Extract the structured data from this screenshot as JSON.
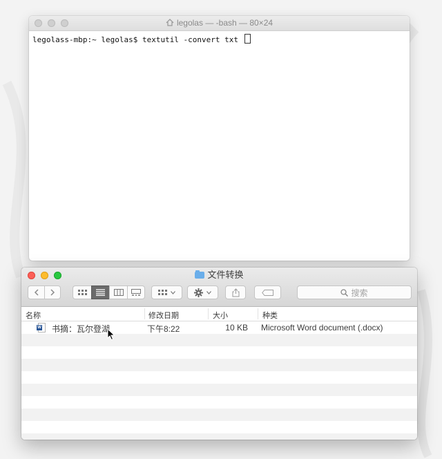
{
  "terminal": {
    "title": "legolas — -bash — 80×24",
    "prompt": "legolass-mbp:~ legolas$ ",
    "command": "textutil -convert txt"
  },
  "finder": {
    "title": "文件转换",
    "search_placeholder": "搜索",
    "columns": {
      "name": "名称",
      "modified": "修改日期",
      "size": "大小",
      "kind": "种类"
    },
    "files": [
      {
        "name": "书摘：瓦尔登湖",
        "modified": "下午8:22",
        "size": "10 KB",
        "kind": "Microsoft Word document (.docx)"
      }
    ]
  }
}
